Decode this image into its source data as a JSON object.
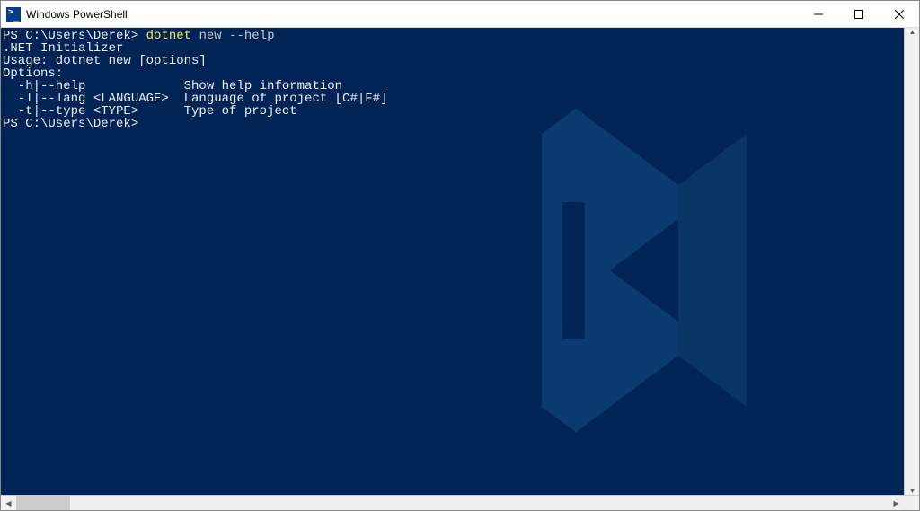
{
  "window": {
    "title": "Windows PowerShell"
  },
  "terminal": {
    "lines": [
      {
        "segments": [
          {
            "text": "PS C:\\Users\\Derek> ",
            "cls": "prompt"
          },
          {
            "text": "dotnet",
            "cls": "cmd-yellow"
          },
          {
            "text": " ",
            "cls": ""
          },
          {
            "text": "new --help",
            "cls": "cmd-gray"
          }
        ]
      },
      {
        "segments": [
          {
            "text": ".NET Initializer",
            "cls": ""
          }
        ]
      },
      {
        "segments": [
          {
            "text": "",
            "cls": ""
          }
        ]
      },
      {
        "segments": [
          {
            "text": "Usage: dotnet new [options]",
            "cls": ""
          }
        ]
      },
      {
        "segments": [
          {
            "text": "",
            "cls": ""
          }
        ]
      },
      {
        "segments": [
          {
            "text": "Options:",
            "cls": ""
          }
        ]
      },
      {
        "segments": [
          {
            "text": "  -h|--help             Show help information",
            "cls": ""
          }
        ]
      },
      {
        "segments": [
          {
            "text": "  -l|--lang <LANGUAGE>  Language of project [C#|F#]",
            "cls": ""
          }
        ]
      },
      {
        "segments": [
          {
            "text": "  -t|--type <TYPE>      Type of project",
            "cls": ""
          }
        ]
      },
      {
        "segments": [
          {
            "text": "PS C:\\Users\\Derek>",
            "cls": "prompt"
          }
        ]
      }
    ]
  }
}
